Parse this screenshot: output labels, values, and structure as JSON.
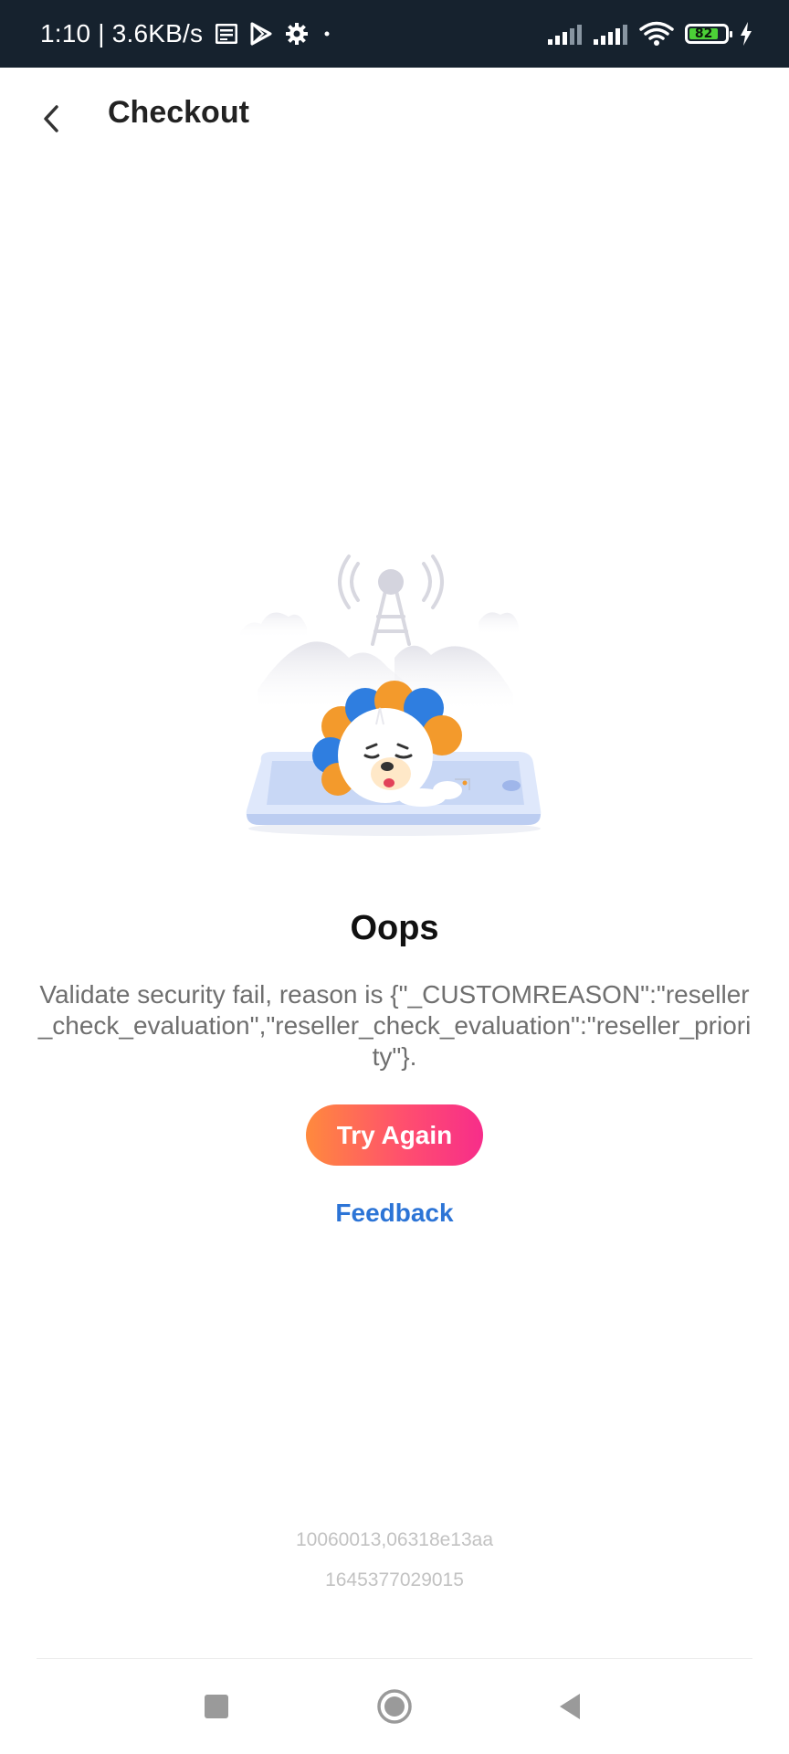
{
  "status_bar": {
    "time": "1:10",
    "separator": "|",
    "network_speed": "3.6KB/s",
    "battery_level": "82",
    "icons": [
      "notes-icon",
      "play-store-icon",
      "settings-gear-icon",
      "notification-dot-icon",
      "signal-icon",
      "signal-icon",
      "wifi-icon",
      "battery-icon",
      "charging-icon"
    ]
  },
  "header": {
    "back_icon": "chevron-left-icon",
    "title": "Checkout"
  },
  "illustration": {
    "name": "lion-sleeping-on-phone-illustration"
  },
  "error": {
    "title": "Oops",
    "message": "Validate security fail, reason is {\"_CUSTOMREASON\":\"reseller_check_evaluation\",\"reseller_check_evaluation\":\"reseller_priority\"}.",
    "try_again_label": "Try Again",
    "feedback_label": "Feedback"
  },
  "debug": {
    "code_line": "10060013,06318e13aa",
    "timestamp_line": "1645377029015"
  },
  "nav_bar": {
    "items": [
      "recent-apps-square-icon",
      "home-circle-icon",
      "back-triangle-icon"
    ]
  },
  "colors": {
    "status_bar_bg": "#16222e",
    "button_gradient_start": "#ff8a3d",
    "button_gradient_end": "#f72d8a",
    "link_color": "#2c74d6"
  }
}
